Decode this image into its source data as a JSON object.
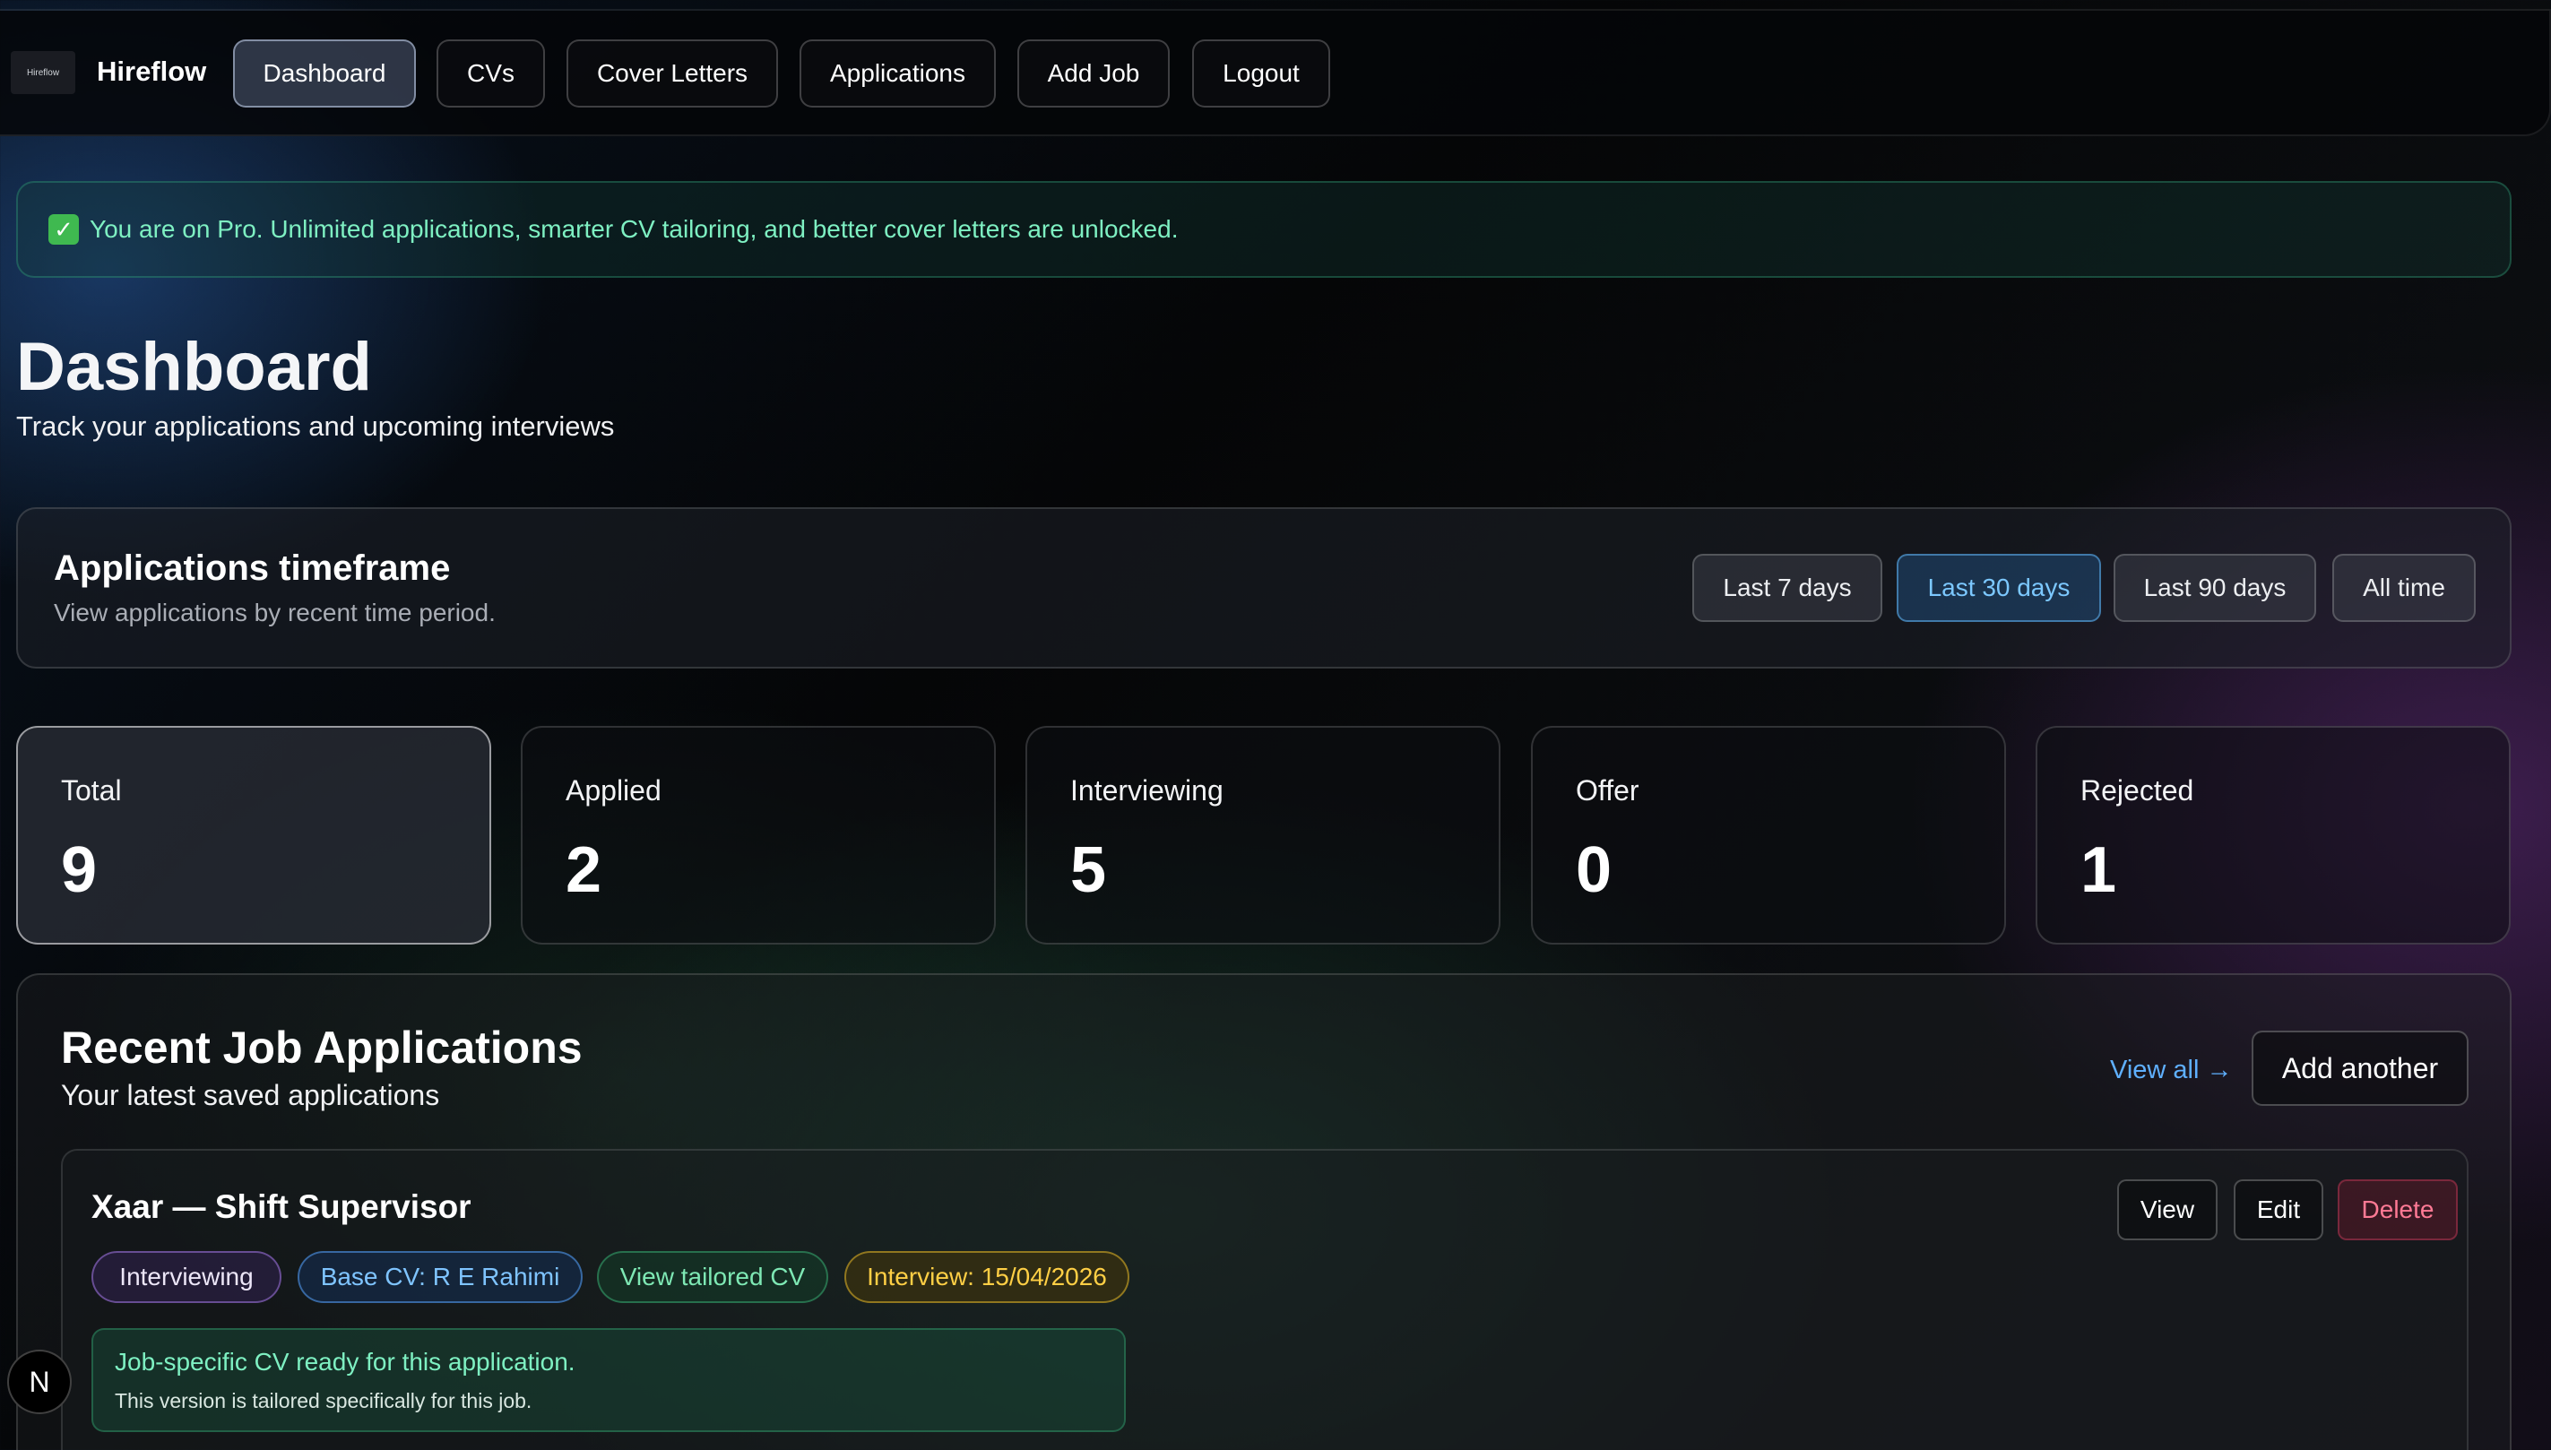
{
  "nav": {
    "logo_text": "Hireflow",
    "brand": "Hireflow",
    "items": [
      {
        "label": "Dashboard",
        "active": true
      },
      {
        "label": "CVs"
      },
      {
        "label": "Cover Letters"
      },
      {
        "label": "Applications"
      },
      {
        "label": "Add Job"
      },
      {
        "label": "Logout"
      }
    ]
  },
  "banner": {
    "icon": "check-icon",
    "text": "You are on Pro. Unlimited applications, smarter CV tailoring, and better cover letters are unlocked."
  },
  "page": {
    "title": "Dashboard",
    "subtitle": "Track your applications and upcoming interviews"
  },
  "timeframe": {
    "title": "Applications timeframe",
    "subtitle": "View applications by recent time period.",
    "options": [
      {
        "label": "Last 7 days"
      },
      {
        "label": "Last 30 days",
        "active": true
      },
      {
        "label": "Last 90 days"
      },
      {
        "label": "All time"
      }
    ]
  },
  "stats": [
    {
      "label": "Total",
      "value": "9",
      "selected": true
    },
    {
      "label": "Applied",
      "value": "2"
    },
    {
      "label": "Interviewing",
      "value": "5"
    },
    {
      "label": "Offer",
      "value": "0"
    },
    {
      "label": "Rejected",
      "value": "1"
    }
  ],
  "recent": {
    "title": "Recent Job Applications",
    "subtitle": "Your latest saved applications",
    "view_all": "View all →",
    "add_another": "Add another",
    "jobs": [
      {
        "title": "Xaar — Shift Supervisor",
        "actions": {
          "view": "View",
          "edit": "Edit",
          "delete": "Delete"
        },
        "tags": {
          "status": "Interviewing",
          "base_cv": "Base CV: R E Rahimi",
          "tailored": "View tailored CV",
          "interview": "Interview: 15/04/2026"
        },
        "cv_ready_title": "Job-specific CV ready for this application.",
        "cv_ready_sub": "This version is tailored specifically for this job."
      }
    ]
  },
  "dev_badge": "N",
  "colors": {
    "accent_blue": "#5fb0ff",
    "success_green": "#7ef0c2",
    "warning_yellow": "#ffcf45",
    "danger_pink": "#ff7a95"
  }
}
